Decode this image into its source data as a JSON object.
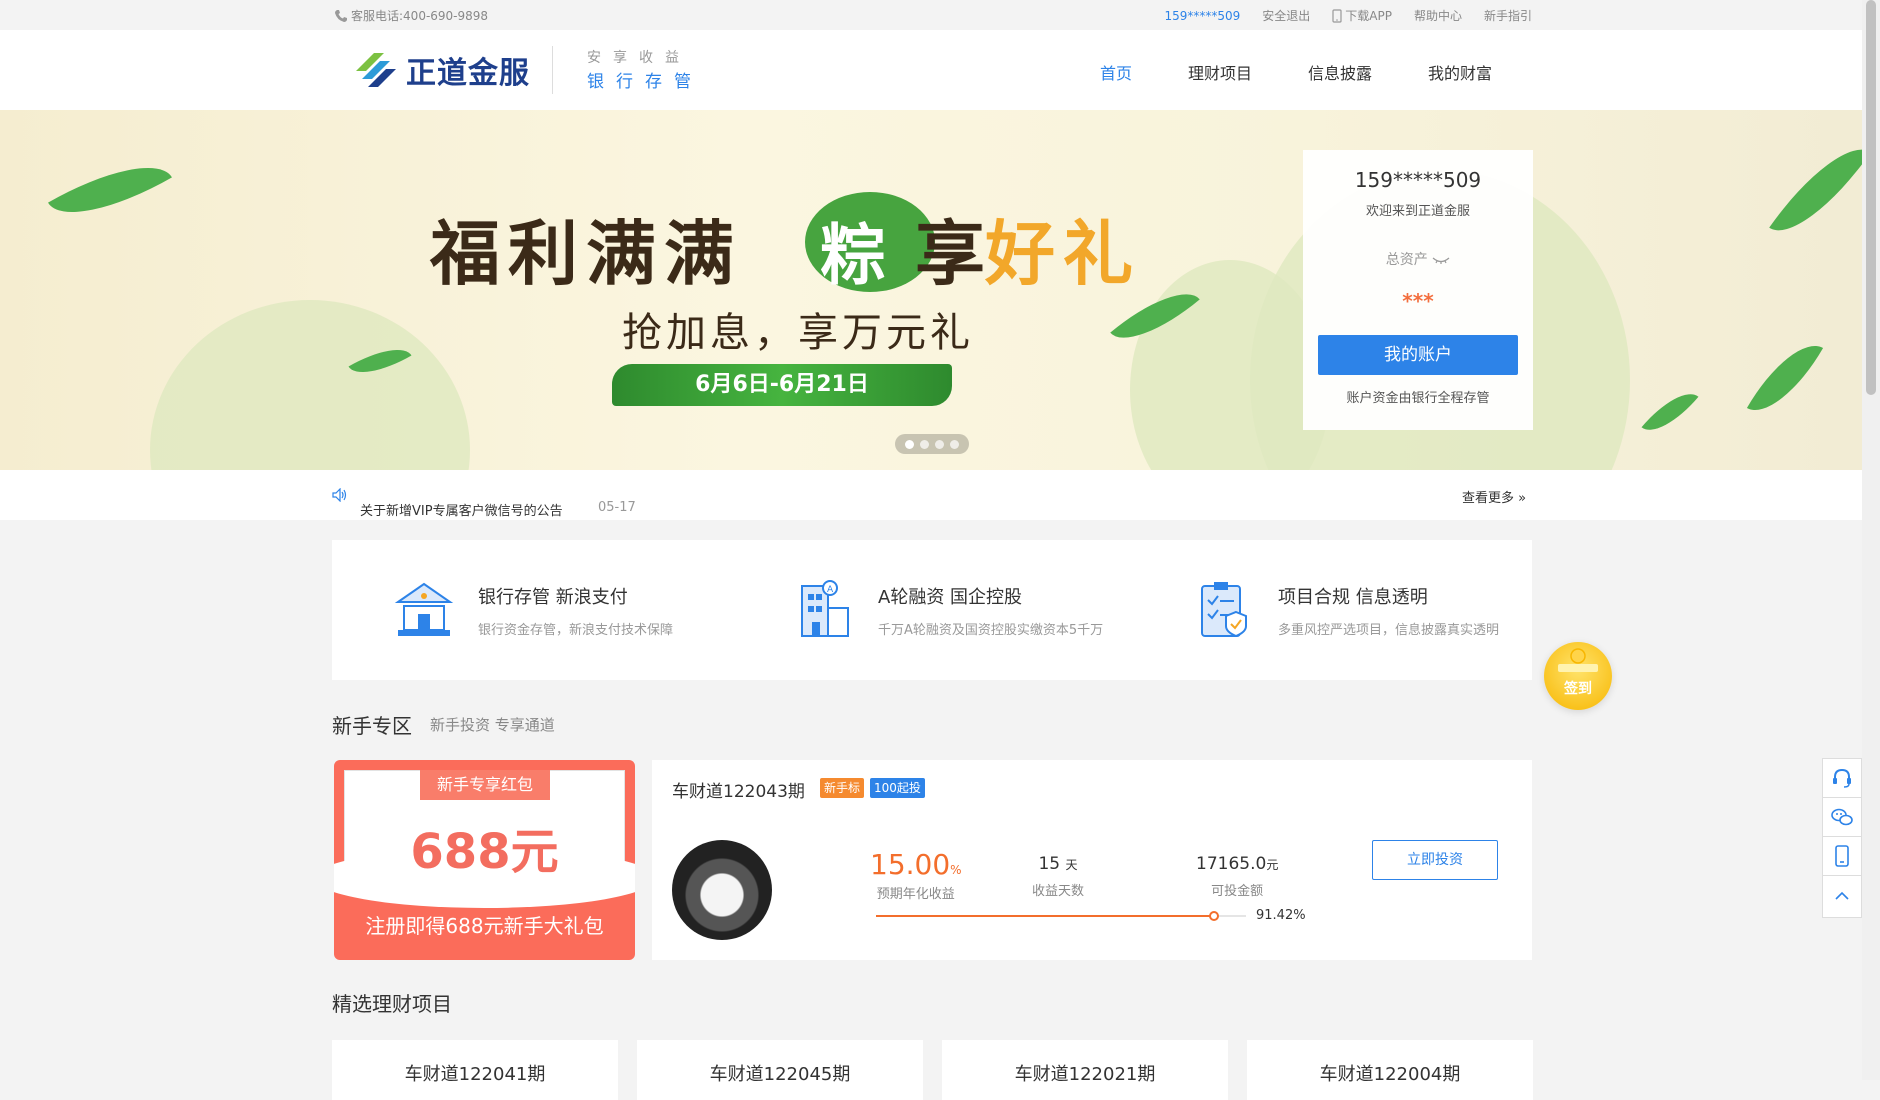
{
  "topbar": {
    "phone": "客服电话:400-690-9898",
    "user": "159*****509",
    "logout": "安全退出",
    "app": "下载APP",
    "help": "帮助中心",
    "guide": "新手指引"
  },
  "header": {
    "brand": "正道金服",
    "slogan1": "安享收益",
    "slogan2": "银行存管",
    "nav": [
      "首页",
      "理财项目",
      "信息披露",
      "我的财富"
    ]
  },
  "banner": {
    "line1": "福利满满",
    "char_zong": "粽",
    "line1b": "享",
    "line1c": "好礼",
    "line2": "抢加息，享万元礼",
    "ribbon": "6月6日-6月21日"
  },
  "account": {
    "user": "159*****509",
    "welcome": "欢迎来到正道金服",
    "total_label": "总资产",
    "total_value": "***",
    "button": "我的账户",
    "note": "账户资金由银行全程存管"
  },
  "notice": {
    "text": "关于新增VIP专属客户微信号的公告",
    "date": "05-17",
    "more": "查看更多"
  },
  "features": [
    {
      "title": "银行存管 新浪支付",
      "sub": "银行资金存管，新浪支付技术保障",
      "icon": "bank-icon"
    },
    {
      "title": "A轮融资 国企控股",
      "sub": "千万A轮融资及国资控股实缴资本5千万",
      "icon": "building-icon"
    },
    {
      "title": "项目合规 信息透明",
      "sub": "多重风控严选项目，信息披露真实透明",
      "icon": "checklist-icon"
    }
  ],
  "newbie": {
    "title": "新手专区",
    "sub": "新手投资 专享通道",
    "packet_tag": "新手专享红包",
    "packet_amount": "688元",
    "packet_desc": "注册即得688元新手大礼包",
    "product": {
      "name": "车财道122043期",
      "badge1": "新手标",
      "badge2": "100起投",
      "rate": "15.00",
      "rate_unit": "%",
      "rate_label": "预期年化收益",
      "days": "15",
      "days_unit": "天",
      "days_label": "收益天数",
      "amount": "17165.0",
      "amount_unit": "元",
      "amount_label": "可投金额",
      "progress": 91.42,
      "progress_text": "91.42%",
      "button": "立即投资"
    }
  },
  "featured": {
    "title": "精选理财项目",
    "items": [
      "车财道122041期",
      "车财道122045期",
      "车财道122021期",
      "车财道122004期"
    ]
  },
  "signin": "签到",
  "colors": {
    "accent": "#2d83e8",
    "orange": "#f36e2c",
    "packet": "#fb6c5a"
  }
}
